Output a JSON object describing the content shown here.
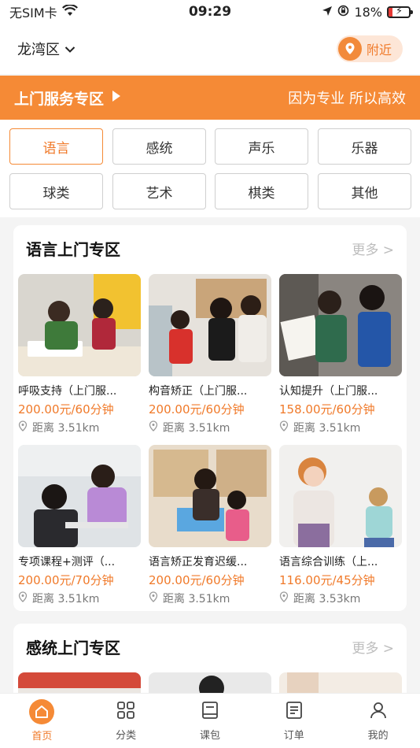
{
  "status_bar": {
    "carrier": "无SIM卡",
    "time": "09:29",
    "battery": "18%"
  },
  "header": {
    "district": "龙湾区",
    "nearby_label": "附近"
  },
  "banner": {
    "title": "上门服务专区",
    "slogan": "因为专业 所以高效"
  },
  "categories": [
    {
      "label": "语言",
      "active": true
    },
    {
      "label": "感统",
      "active": false
    },
    {
      "label": "声乐",
      "active": false
    },
    {
      "label": "乐器",
      "active": false
    },
    {
      "label": "球类",
      "active": false
    },
    {
      "label": "艺术",
      "active": false
    },
    {
      "label": "棋类",
      "active": false
    },
    {
      "label": "其他",
      "active": false
    }
  ],
  "sections": [
    {
      "title": "语言上门专区",
      "more_label": "更多 >",
      "items": [
        {
          "name": "呼吸支持（上门服...",
          "price": "200.00元/60分钟",
          "distance": "距离 3.51km"
        },
        {
          "name": "构音矫正（上门服...",
          "price": "200.00元/60分钟",
          "distance": "距离 3.51km"
        },
        {
          "name": "认知提升（上门服...",
          "price": "158.00元/60分钟",
          "distance": "距离 3.51km"
        },
        {
          "name": "专项课程+测评（...",
          "price": "200.00元/70分钟",
          "distance": "距离 3.51km"
        },
        {
          "name": "语言矫正发育迟缓...",
          "price": "200.00元/60分钟",
          "distance": "距离 3.51km"
        },
        {
          "name": "语言综合训练（上...",
          "price": "116.00元/45分钟",
          "distance": "距离 3.53km"
        }
      ]
    },
    {
      "title": "感统上门专区",
      "more_label": "更多 >"
    }
  ],
  "tabbar": [
    {
      "label": "首页",
      "icon": "home-icon",
      "active": true
    },
    {
      "label": "分类",
      "icon": "grid-icon",
      "active": false
    },
    {
      "label": "课包",
      "icon": "book-icon",
      "active": false
    },
    {
      "label": "订单",
      "icon": "order-list-icon",
      "active": false
    },
    {
      "label": "我的",
      "icon": "user-icon",
      "active": false
    }
  ],
  "colors": {
    "accent": "#f58a36",
    "accent_text": "#f07a2a",
    "background": "#f4f4f4"
  }
}
